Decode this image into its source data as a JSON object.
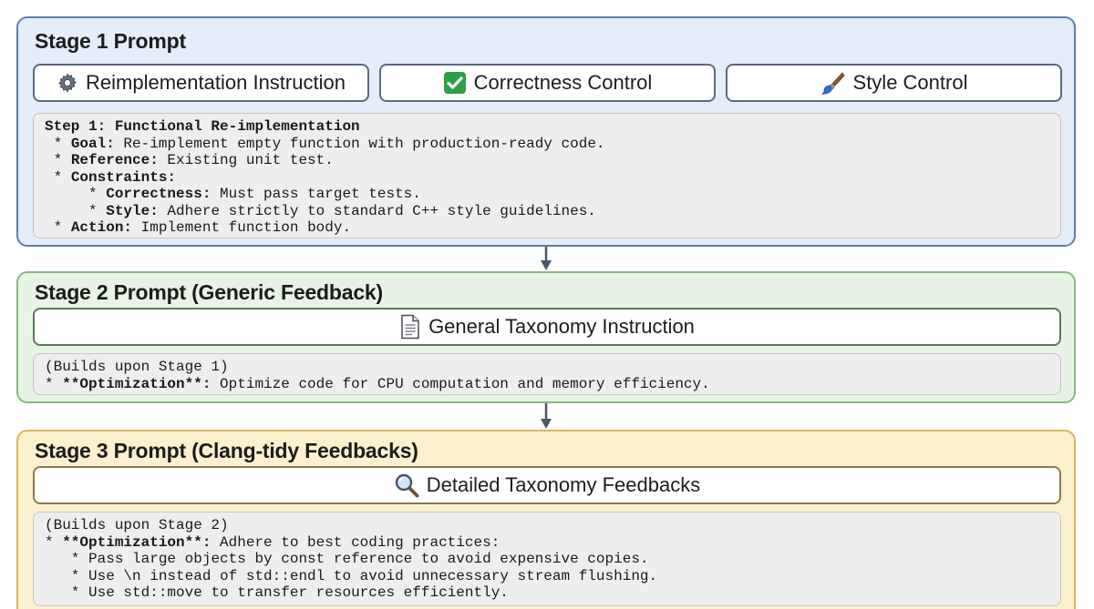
{
  "stage1": {
    "title": "Stage 1 Prompt",
    "tabs": {
      "reimplementation": "Reimplementation Instruction",
      "correctness": "Correctness Control",
      "style": "Style Control"
    },
    "code": {
      "l1": "Step 1: Functional Re-implementation",
      "goal_key": "Goal:",
      "goal_val": " Re-implement empty function with production-ready code.",
      "ref_key": "Reference:",
      "ref_val": " Existing unit test.",
      "cons_key": "Constraints:",
      "corr_key": "Correctness:",
      "corr_val": " Must pass target tests.",
      "style_key": "Style:",
      "style_val": " Adhere strictly to standard C++ style guidelines.",
      "action_key": "Action:",
      "action_val": " Implement function body."
    }
  },
  "stage2": {
    "title": "Stage 2 Prompt (Generic Feedback)",
    "instruction": "General Taxonomy Instruction",
    "code": {
      "l1": "(Builds upon Stage 1)",
      "opt_key": "**Optimization**:",
      "opt_val": " Optimize code for CPU computation and memory efficiency."
    }
  },
  "stage3": {
    "title": "Stage 3 Prompt (Clang-tidy Feedbacks)",
    "instruction": "Detailed Taxonomy Feedbacks",
    "code": {
      "l1": "(Builds upon Stage 2)",
      "opt_key": "**Optimization**:",
      "opt_val": " Adhere to best coding practices:",
      "b1": "Pass large objects by const reference to avoid expensive copies.",
      "b2": "Use \\n instead of std::endl to avoid unnecessary stream flushing.",
      "b3": "Use std::move to transfer resources efficiently."
    }
  },
  "icons": {
    "gear": "gear-icon",
    "check": "checkmark-icon",
    "brush": "paintbrush-icon",
    "document": "document-icon",
    "magnifier": "magnifier-icon",
    "arrow": "arrow-down-icon"
  },
  "colors": {
    "stage1_bg": "#e4edf8",
    "stage1_border": "#5d7fa7",
    "stage2_bg": "#e7f3e4",
    "stage2_border": "#86b87f",
    "stage3_bg": "#fcf0cf",
    "stage3_border": "#d7b760",
    "check_green": "#2ea043",
    "arrow": "#4a5566"
  }
}
